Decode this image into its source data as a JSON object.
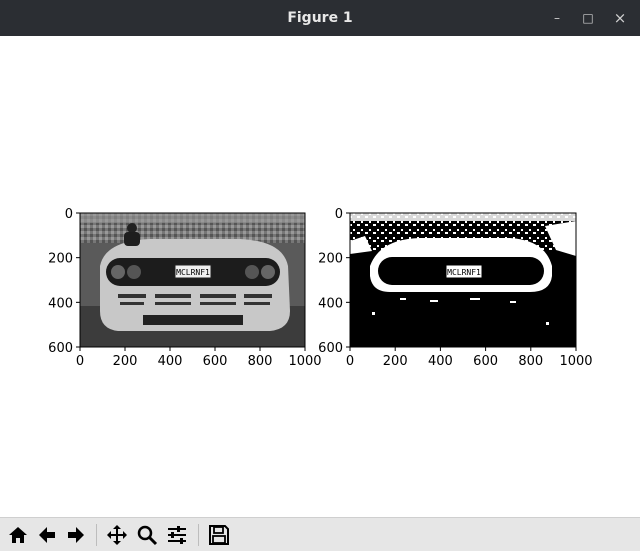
{
  "window": {
    "title": "Figure 1",
    "controls": {
      "minimize": "–",
      "maximize": "□",
      "close": "×"
    }
  },
  "figure": {
    "left_panel": {
      "content": "grayscale photograph of a car front with license plate"
    },
    "right_panel": {
      "content": "binary thresholded image of the same car front"
    },
    "plate_text": "MCLRNF1"
  },
  "chart_data": [
    {
      "type": "image",
      "xticks": [
        "0",
        "200",
        "400",
        "600",
        "800",
        "1000"
      ],
      "yticks": [
        "0",
        "200",
        "400",
        "600"
      ],
      "xlim": [
        0,
        1000
      ],
      "ylim": [
        600,
        0
      ]
    },
    {
      "type": "image",
      "xticks": [
        "0",
        "200",
        "400",
        "600",
        "800",
        "1000"
      ],
      "yticks": [
        "0",
        "200",
        "400",
        "600"
      ],
      "xlim": [
        0,
        1000
      ],
      "ylim": [
        600,
        0
      ]
    }
  ],
  "toolbar": {
    "buttons": [
      "home-icon",
      "back-icon",
      "forward-icon",
      "pan-icon",
      "zoom-icon",
      "configure-subplots-icon",
      "save-icon"
    ]
  }
}
